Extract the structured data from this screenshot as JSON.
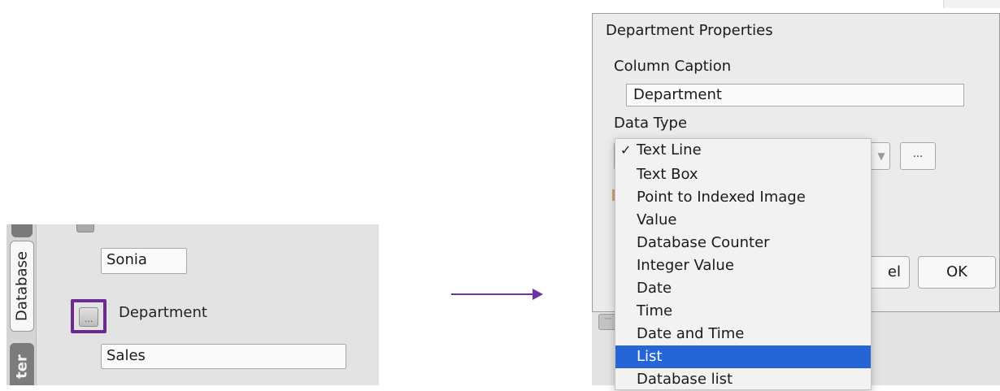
{
  "left_panel": {
    "tabs": [
      "Database",
      "ter"
    ],
    "name_value": "Sonia",
    "department_label": "Department",
    "department_value": "Sales",
    "ellipsis": "..."
  },
  "dialog": {
    "title": "Department Properties",
    "caption_label": "Column Caption",
    "caption_value": "Department",
    "data_type_label": "Data Type",
    "more_button": "...",
    "cancel_fragment": "el",
    "ok_button": "OK"
  },
  "dropdown": {
    "items": [
      "Text Line",
      "Text Box",
      "Point to Indexed Image",
      "Value",
      "Database Counter",
      "Integer Value",
      "Date",
      "Time",
      "Date and Time",
      "List",
      "Database list"
    ],
    "checked_item": "Text Line",
    "highlighted_item": "List",
    "check_mark": "✓"
  },
  "colors": {
    "highlight_border": "#6b2c8f",
    "arrow": "#6b35a3",
    "selection": "#2665d6"
  }
}
